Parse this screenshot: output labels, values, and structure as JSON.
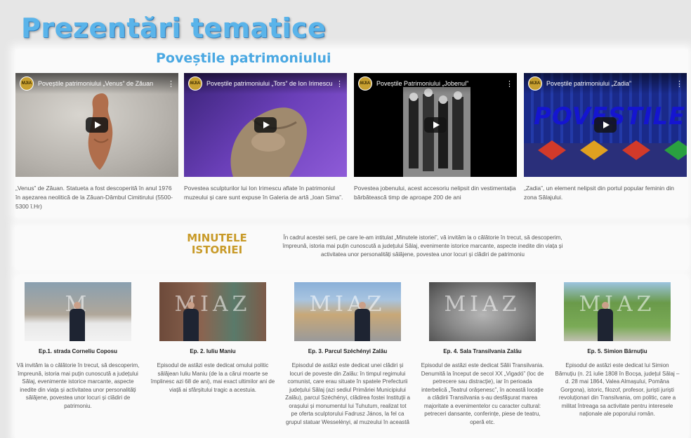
{
  "page": {
    "title": "Prezentări tematice"
  },
  "povestile": {
    "subtitle": "Poveștile patrimoniului",
    "videos": [
      {
        "title": "Poveștile patrimoniului „Venus” de Zăuan",
        "desc": "„Venus” de Zăuan. Statueta a fost descoperită în anul 1976 în așezarea neolitică de la Zăuan-Dâmbul Cimitirului (5500-5300 î.Hr)",
        "play": "play-icon"
      },
      {
        "title": "Poveștile patrimoniului „Tors” de Ion Irimescu",
        "desc": "Povestea sculpturilor lui Ion Irimescu aflate în patrimoniul muzeului și care sunt expuse în Galeria de artă „Ioan Sima”.",
        "play": "play-icon"
      },
      {
        "title": "Poveștile Patrimoniului „Jobenul”",
        "desc": "Povestea jobenului, acest accesoriu nelipsit din vestimentația bărbătească timp de aproape 200 de ani",
        "play": "play-icon"
      },
      {
        "title": "Poveștile patrimoniului „Zadia”",
        "desc": "„Zadia”, un element nelipsit din portul popular feminin din zona Sălajului.",
        "overlay": "POVEȘTILE",
        "play": "play-icon"
      }
    ],
    "channel_badge": "MJIA"
  },
  "minutele": {
    "title_line1": "MINUTELE",
    "title_line2": "ISTORIEI",
    "desc": "În cadrul acestei serii, pe care le-am intitulat „Minutele istoriei”, vă invităm la o călătorie în trecut, să descoperim, împreună, istoria mai puțin cunoscută a județului Sălaj, evenimente istorice marcante, aspecte inedite din viața și activitatea unor personalități sălăjene, povestea unor locuri și clădiri de patrimoniu"
  },
  "episodes": [
    {
      "title": "Ep.1. strada Corneliu Coposu",
      "desc": "Vă invităm la o călătorie în trecut, să descoperim, împreună, istoria mai puțin cunoscută a județului Sălaj, evenimente istorice marcante, aspecte inedite din viața și activitatea unor personalități sălăjene, povestea unor locuri și clădiri de patrimoniu.",
      "mark": "M"
    },
    {
      "title": "Ep. 2. Iuliu Maniu",
      "desc": "Episodul de astăzi este dedicat omului politic sălăjean Iuliu Maniu (de la a cărui moarte se împlinesc azi 68 de ani), mai exact ultimilor ani de viață ai sfârșitului tragic a acestuia.",
      "mark": "MIAZ"
    },
    {
      "title": "Ep. 3. Parcul Széchényi Zalău",
      "desc": "Episodul de astăzi este dedicat unei clădiri și locuri de poveste din Zalău: în timpul regimului comunist, care erau situate în spatele Prefecturii județului Sălaj (azi sediul Primăriei Municipiului Zalău), parcul Széchényi, clădirea fostei Instituții a orașului și monumentul lui Tuhutum, realizat tot pe oferta sculptorului Fadrusz János, la fel ca grupul statuar Wesselényi, al muzeului în această",
      "mark": "MIAZ"
    },
    {
      "title": "Ep. 4. Sala Transilvania Zalău",
      "desc": "Episodul de astăzi este dedicat Sălii Transilvania. Denumită la început de secol XX „Vigadó” (loc de petrecere sau distracție), iar în perioada interbelică „Teatrul orășenesc”, în această locație a clădirii Transilvania s-au desfășurat marea majoritate a evenimentelor cu caracter cultural: petreceri dansante, conferințe, piese de teatru, operă etc.",
      "mark": "MIAZ"
    },
    {
      "title": "Ep. 5. Simion Bărnuțiu",
      "desc": "Episodul de astăzi este dedicat lui Simion Bărnuțiu (n. 21 iulie 1808 în Bocșa, județul Sălaj – d. 28 mai 1864, Valea Almașului, Pomăna Gorgona), istoric, filozof, profesor, juriști juriști revoluționari din Transilvania, om politic, care a militat întreaga sa activitate pentru interesele naționale ale poporului român.",
      "mark": "MIAZ"
    }
  ],
  "colors": {
    "title_blue": "#5ab4ea",
    "sub_blue": "#4aa8e2",
    "gold": "#c89a28"
  }
}
